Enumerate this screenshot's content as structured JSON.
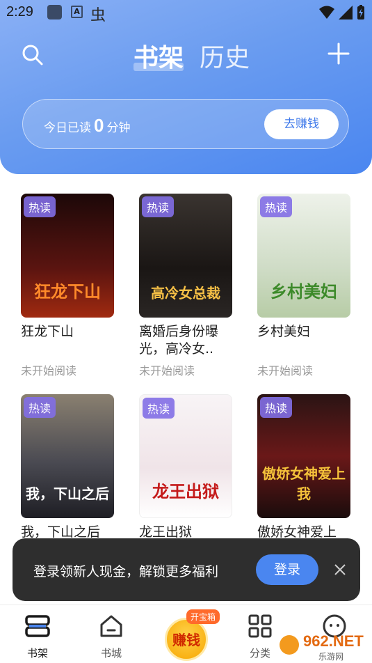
{
  "status_bar": {
    "time": "2:29",
    "a_icon_label": "A",
    "bug_glyph": "虫"
  },
  "top_nav": {
    "tabs": [
      {
        "label": "书架",
        "active": true
      },
      {
        "label": "历史",
        "active": false
      }
    ]
  },
  "reading_card": {
    "prefix": "今日已读",
    "minutes": "0",
    "suffix": "分钟",
    "button_label": "去赚钱"
  },
  "books": [
    {
      "badge": "热读",
      "cover_title": "狂龙下山",
      "name": "狂龙下山",
      "progress": "未开始阅读",
      "cover_color": "#5a1410",
      "cover_accent": "#ff6a1a"
    },
    {
      "badge": "热读",
      "cover_title": "高冷女总裁",
      "name": "离婚后身份曝光，高冷女..",
      "progress": "未开始阅读",
      "cover_color": "#2a2624",
      "cover_accent": "#f6c046"
    },
    {
      "badge": "热读",
      "cover_title": "乡村美妇",
      "name": "乡村美妇",
      "progress": "未开始阅读",
      "cover_color": "#dfe6d6",
      "cover_accent": "#3d8a2a"
    },
    {
      "badge": "热读",
      "cover_title": "我，下山之后",
      "name": "我，下山之后",
      "progress": "",
      "cover_color": "#4a4a52",
      "cover_accent": "#ffffff"
    },
    {
      "badge": "热读",
      "cover_title": "龙王出狱",
      "name": "龙王出狱",
      "progress": "",
      "cover_color": "#f3eef0",
      "cover_accent": "#c41a1a"
    },
    {
      "badge": "热读",
      "cover_title": "傲娇女神爱上我",
      "name": "傲娇女神爱上",
      "progress": "",
      "cover_color": "#3a1818",
      "cover_accent": "#f5c23a"
    }
  ],
  "toast": {
    "message": "登录领新人现金，解锁更多福利",
    "login_label": "登录"
  },
  "tabbar": {
    "items": [
      {
        "label": "书架",
        "active": true
      },
      {
        "label": "书城",
        "active": false
      },
      {
        "label": "分类",
        "active": false
      }
    ],
    "earn": {
      "center_label": "赚钱",
      "tag": "开宝箱"
    }
  },
  "watermark": {
    "brand": "962.NET",
    "sub": "乐游网"
  },
  "colors": {
    "header_blue": "#4a86f0",
    "accent_blue": "#3d78ea",
    "badge_purple": "#826ee6",
    "toast_bg": "#2e2e2e"
  }
}
